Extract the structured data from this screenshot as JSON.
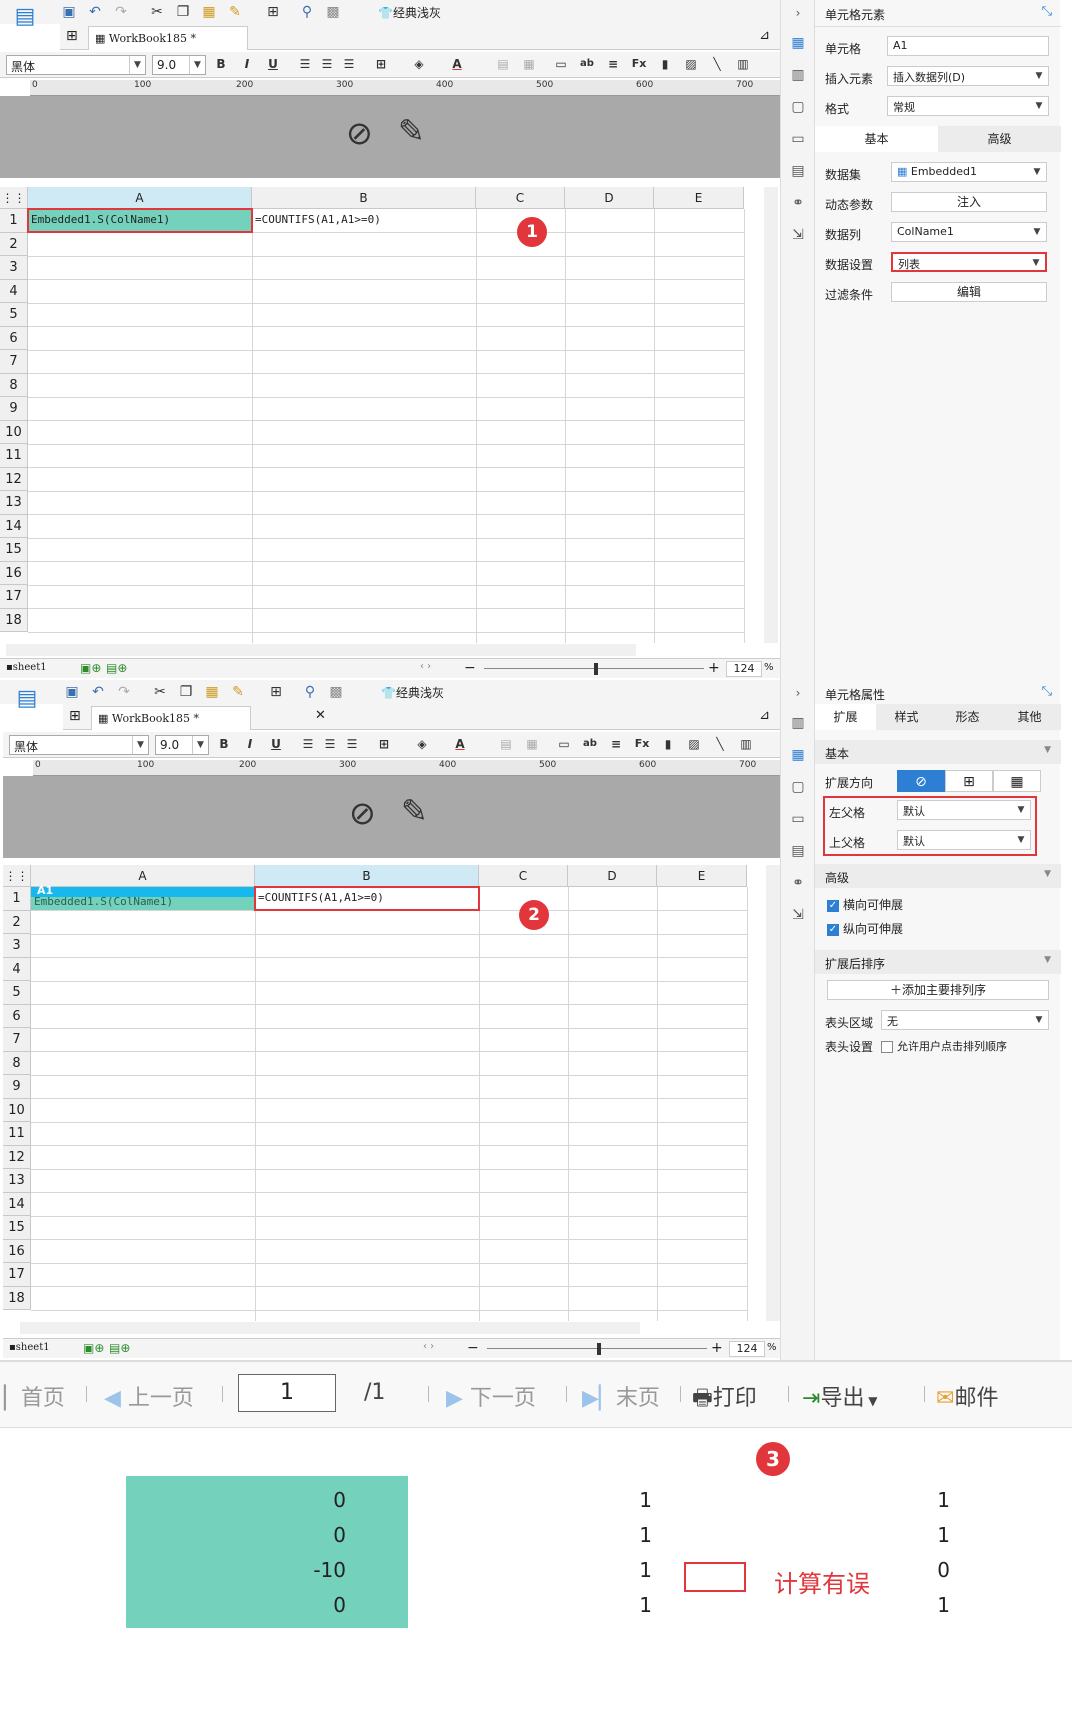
{
  "p1": {
    "toolbar": {
      "classic_gray": "经典浅灰"
    },
    "doc_tab": "WorkBook185 *",
    "format": {
      "font": "黑体",
      "size": "9.0",
      "bold": "B",
      "italic": "I",
      "underline": "U"
    },
    "ruler": [
      "0",
      "100",
      "200",
      "300",
      "400",
      "500",
      "600",
      "700"
    ],
    "columns": [
      "A",
      "B",
      "C",
      "D",
      "E"
    ],
    "rows": [
      "1",
      "2",
      "3",
      "4",
      "5",
      "6",
      "7",
      "8",
      "9",
      "10",
      "11",
      "12",
      "13",
      "14",
      "15",
      "16",
      "17",
      "18"
    ],
    "cell_a1": "Embedded1.S(ColName1)",
    "cell_b1": "=COUNTIFS(A1,A1>=0)",
    "badge": "1",
    "sheet_tab": "sheet1",
    "zoom": "124",
    "pct": "%",
    "side": {
      "title": "单元格元素",
      "cell_label": "单元格",
      "cell_value": "A1",
      "insert_label": "插入元素",
      "insert_value": "插入数据列(D)",
      "format_label": "格式",
      "format_value": "常规",
      "tab_basic": "基本",
      "tab_advanced": "高级",
      "dataset_label": "数据集",
      "dataset_value": "Embedded1",
      "param_label": "动态参数",
      "param_button": "注入",
      "column_label": "数据列",
      "column_value": "ColName1",
      "setting_label": "数据设置",
      "setting_value": "列表",
      "filter_label": "过滤条件",
      "filter_button": "编辑"
    }
  },
  "p2": {
    "toolbar": {
      "classic_gray": "经典浅灰"
    },
    "doc_tab": "WorkBook185 *",
    "format": {
      "font": "黑体",
      "size": "9.0",
      "bold": "B",
      "italic": "I",
      "underline": "U"
    },
    "ruler": [
      "0",
      "100",
      "200",
      "300",
      "400",
      "500",
      "600",
      "700"
    ],
    "columns": [
      "A",
      "B",
      "C",
      "D",
      "E"
    ],
    "rows": [
      "1",
      "2",
      "3",
      "4",
      "5",
      "6",
      "7",
      "8",
      "9",
      "10",
      "11",
      "12",
      "13",
      "14",
      "15",
      "16",
      "17",
      "18"
    ],
    "cell_a1_tag": "A1",
    "cell_a1": "Embedded1.S(ColName1)",
    "cell_b1": "=COUNTIFS(A1,A1>=0)",
    "badge": "2",
    "sheet_tab": "sheet1",
    "zoom": "124",
    "pct": "%",
    "side": {
      "title": "单元格属性",
      "tabs": [
        "扩展",
        "样式",
        "形态",
        "其他"
      ],
      "basic": "基本",
      "dir_label": "扩展方向",
      "left_parent_label": "左父格",
      "left_parent_value": "默认",
      "top_parent_label": "上父格",
      "top_parent_value": "默认",
      "advanced": "高级",
      "h_expand": "横向可伸展",
      "v_expand": "纵向可伸展",
      "sort_section": "扩展后排序",
      "add_sort": "添加主要排列序",
      "header_area_label": "表头区域",
      "header_area_value": "无",
      "header_set_label": "表头设置",
      "header_set_value": "允许用户点击排列顺序"
    }
  },
  "p3": {
    "nav": {
      "first": "首页",
      "prev": "上一页",
      "page": "1",
      "total": "/1",
      "next": "下一页",
      "last": "末页",
      "print": "打印",
      "export": "导出",
      "mail": "邮件"
    },
    "badge": "3",
    "col1": [
      "0",
      "0",
      "-10",
      "0"
    ],
    "col2": [
      "1",
      "1",
      "1",
      "1"
    ],
    "col3": [
      "1",
      "1",
      "0",
      "1"
    ],
    "error_note": "计算有误"
  },
  "colors": {
    "accent": "#2d7fd3",
    "red": "#e0363c",
    "green": "#74d2bc"
  }
}
